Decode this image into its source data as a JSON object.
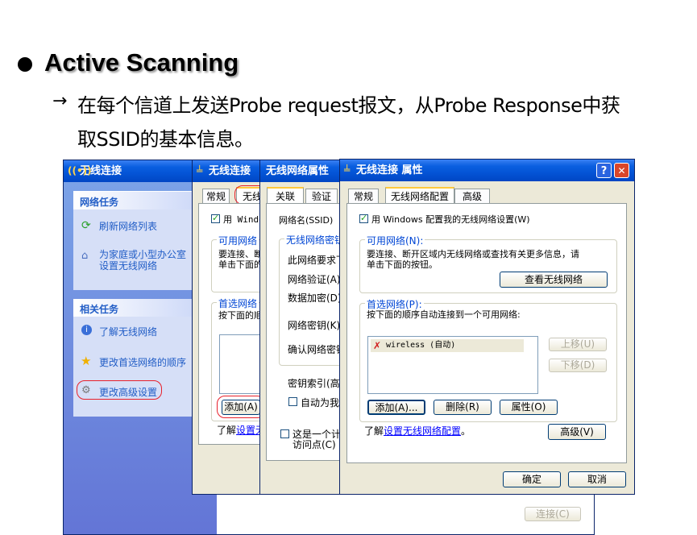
{
  "slide": {
    "heading": "Active Scanning",
    "arrow": "→",
    "line1": "在每个信道上发送Probe request报文，从Probe Response中获",
    "line2": "取SSID的基本信息。"
  },
  "win1": {
    "title": "无线连接",
    "network_tasks": "网络任务",
    "refresh": "刷新网络列表",
    "setup": "为家庭或小型办公室设置无线网络",
    "related_tasks": "相关任务",
    "learn": "了解无线网络",
    "change_order": "更改首选网络的顺序",
    "change_adv": "更改高级设置",
    "connect": "连接(C)"
  },
  "win2": {
    "title": "无线连接",
    "tab_general": "常规",
    "tab_wireless": "无线",
    "use_windows": "用 Windo",
    "available": "可用网络",
    "avail_text1": "要连接、断",
    "avail_text2": "单击下面的",
    "preferred": "首选网络",
    "pref_text": "按下面的顺",
    "add": "添加(A)",
    "learn": "了解",
    "learn_link": "设置无"
  },
  "win3": {
    "title": "无线网络属性",
    "tab_assoc": "关联",
    "tab_auth": "验证",
    "ssid": "网络名(SSID)",
    "key_group": "无线网络密钥",
    "needs": "此网络要求下",
    "auth": "网络验证(A)",
    "encrypt": "数据加密(D)",
    "netkey": "网络密钥(K)",
    "confirm": "确认网络密钥",
    "keyindex": "密钥索引(高",
    "auto": "自动为我",
    "adhoc1": "这是一个计",
    "adhoc2": "访问点(C)"
  },
  "win4": {
    "title": "无线连接 属性",
    "tab_general": "常规",
    "tab_wireless": "无线网络配置",
    "tab_advanced": "高级",
    "use_windows": "用 Windows 配置我的无线网络设置(W)",
    "available_title": "可用网络(N):",
    "available_text1": "要连接、断开区域内无线网络或查找有关更多信息，请",
    "available_text2": "单击下面的按钮。",
    "view_button": "查看无线网络",
    "preferred_title": "首选网络(P):",
    "preferred_text": "按下面的顺序自动连接到一个可用网络:",
    "network_item": "wireless (自动)",
    "up": "上移(U)",
    "down": "下移(D)",
    "add": "添加(A)...",
    "remove": "删除(R)",
    "properties": "属性(O)",
    "learn_prefix": "了解",
    "learn_link": "设置无线网络配置",
    "learn_suffix": "。",
    "advanced": "高级(V)",
    "ok": "确定",
    "cancel": "取消",
    "help": "?",
    "close": "✕"
  }
}
